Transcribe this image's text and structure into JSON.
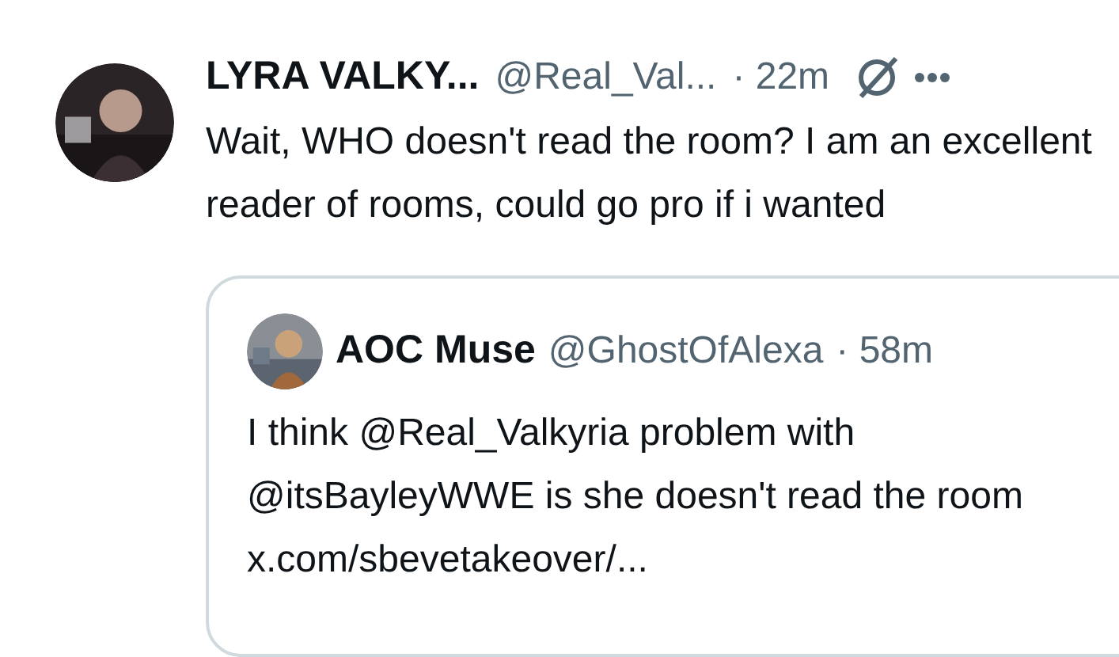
{
  "post": {
    "author": {
      "name": "LYRA VALKY...",
      "handle": "@Real_Val...",
      "time": "· 22m"
    },
    "text": "Wait, WHO doesn't read the room? I am an excellent reader of rooms, could go pro if i wanted",
    "quote": {
      "author": {
        "name": "AOC Muse",
        "handle": "@GhostOfAlexa",
        "time": "· 58m"
      },
      "text": "I think @Real_Valkyria problem with @itsBayleyWWE is she doesn't read the room x.com/sbevetakeover/..."
    }
  }
}
